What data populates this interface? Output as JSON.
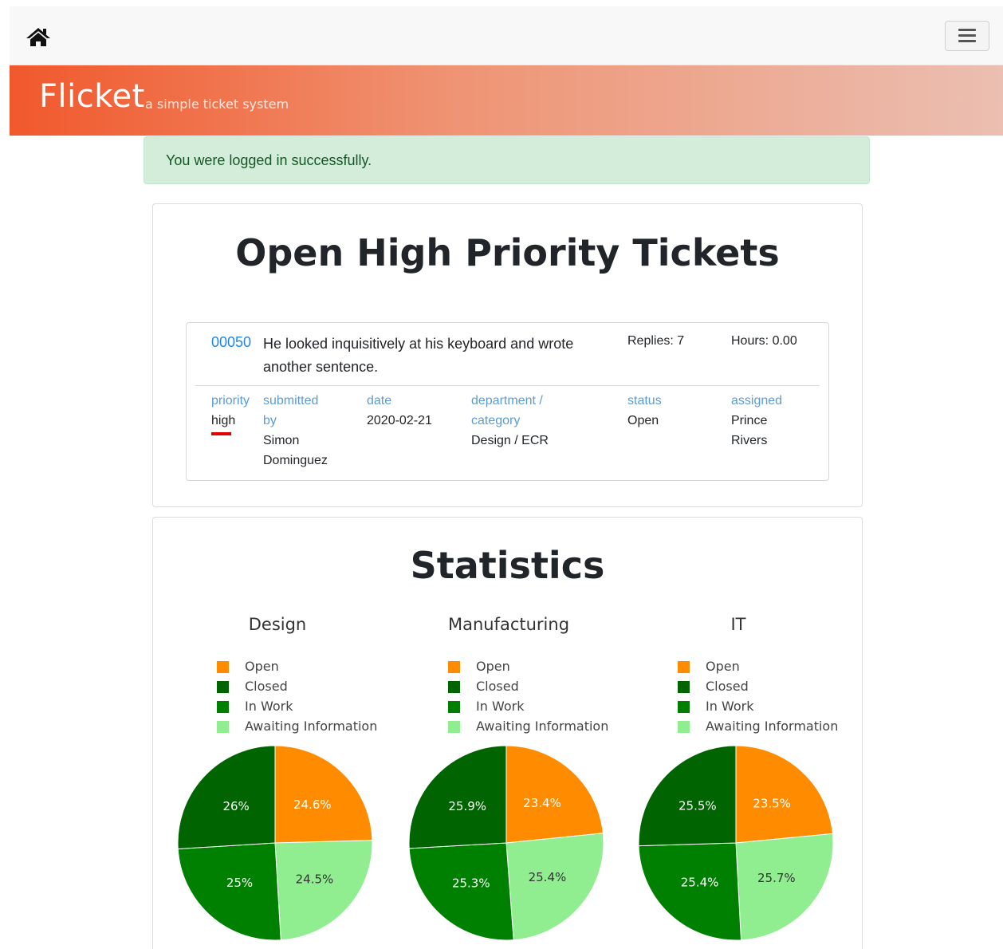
{
  "brand": {
    "name": "Flicket",
    "tagline": "a simple ticket system"
  },
  "alert": {
    "message": "You were logged in successfully."
  },
  "open_high": {
    "title": "Open High Priority Tickets",
    "ticket": {
      "id": "00050",
      "subject_line1": "He looked inquisitively at his keyboard and wrote",
      "subject_line2": "another sentence.",
      "replies": "Replies: 7",
      "hours": "Hours: 0.00",
      "labels": {
        "priority": "priority",
        "submitted_1": "submitted",
        "submitted_2": "by",
        "date": "date",
        "dept_1": "department /",
        "dept_2": "category",
        "status": "status",
        "assigned": "assigned"
      },
      "values": {
        "priority": "high",
        "submitted_1": "Simon",
        "submitted_2": "Dominguez",
        "date": "2020-02-21",
        "dept": "Design / ECR",
        "status": "Open",
        "assigned_1": "Prince",
        "assigned_2": "Rivers"
      },
      "priority_color": "#e00000"
    }
  },
  "statistics": {
    "title": "Statistics"
  },
  "legend_labels": [
    "Open",
    "Closed",
    "In Work",
    "Awaiting Information"
  ],
  "colors": {
    "Open": "#ff8c00",
    "Closed": "#006400",
    "In Work": "#008000",
    "Awaiting Information": "#90ee90"
  },
  "chart_data": [
    {
      "type": "pie",
      "title": "Design",
      "slices": [
        {
          "label": "Open",
          "value": 24.6,
          "text": "24.6%"
        },
        {
          "label": "Awaiting Information",
          "value": 24.5,
          "text": "24.5%"
        },
        {
          "label": "In Work",
          "value": 25.0,
          "text": "25%"
        },
        {
          "label": "Closed",
          "value": 26.0,
          "text": "26%"
        }
      ]
    },
    {
      "type": "pie",
      "title": "Manufacturing",
      "slices": [
        {
          "label": "Open",
          "value": 23.4,
          "text": "23.4%"
        },
        {
          "label": "Awaiting Information",
          "value": 25.4,
          "text": "25.4%"
        },
        {
          "label": "In Work",
          "value": 25.3,
          "text": "25.3%"
        },
        {
          "label": "Closed",
          "value": 25.9,
          "text": "25.9%"
        }
      ]
    },
    {
      "type": "pie",
      "title": "IT",
      "slices": [
        {
          "label": "Open",
          "value": 23.5,
          "text": "23.5%"
        },
        {
          "label": "Awaiting Information",
          "value": 25.7,
          "text": "25.7%"
        },
        {
          "label": "In Work",
          "value": 25.4,
          "text": "25.4%"
        },
        {
          "label": "Closed",
          "value": 25.5,
          "text": "25.5%"
        }
      ]
    }
  ]
}
